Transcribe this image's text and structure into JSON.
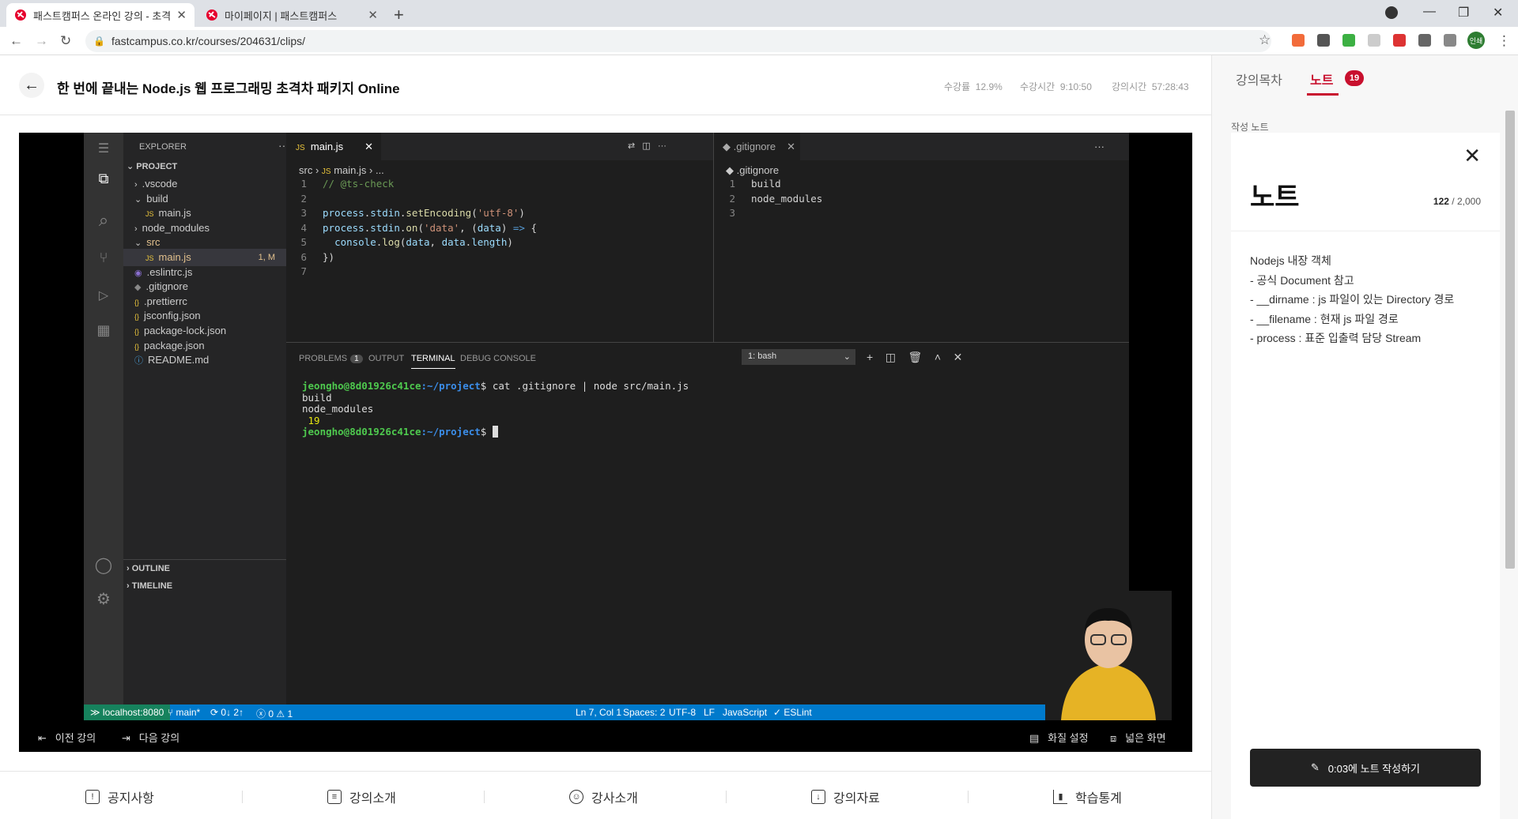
{
  "browser": {
    "tabs": [
      {
        "title": "패스트캠퍼스 온라인 강의 - 초격",
        "active": true
      },
      {
        "title": "마이페이지 | 패스트캠퍼스",
        "active": false
      }
    ],
    "url": "fastcampus.co.kr/courses/204631/clips/",
    "profile_label": "인쇄"
  },
  "header": {
    "title": "한 번에 끝내는 Node.js 웹 프로그래밍 초격차 패키지 Online",
    "progress_label": "수강률",
    "progress_value": "12.9%",
    "watch_time_label": "수강시간",
    "watch_time_value": "9:10:50",
    "lecture_time_label": "강의시간",
    "lecture_time_value": "57:28:43"
  },
  "right_panel": {
    "tabs": [
      {
        "label": "강의목차",
        "active": false
      },
      {
        "label": "노트",
        "active": true
      }
    ],
    "note_badge": "19",
    "section_label": "작성 노트",
    "note_heading": "노트",
    "char_count": "122",
    "char_limit": "/ 2,000",
    "note_lines": [
      "Nodejs 내장 객체",
      "- 공식 Document 참고",
      "- __dirname : js 파일이 있는 Directory 경로",
      "- __filename : 현재 js 파일 경로",
      "- process : 표준 입출력 담당 Stream"
    ],
    "write_button": "0:03에 노트 작성하기"
  },
  "vscode": {
    "explorer_title": "EXPLORER",
    "project_label": "PROJECT",
    "files": [
      {
        "name": ".vscode",
        "indent": 1,
        "type": "folder"
      },
      {
        "name": "build",
        "indent": 1,
        "type": "folder-open"
      },
      {
        "name": "main.js",
        "indent": 2,
        "type": "js"
      },
      {
        "name": "node_modules",
        "indent": 1,
        "type": "folder"
      },
      {
        "name": "src",
        "indent": 1,
        "type": "folder-open"
      },
      {
        "name": "main.js",
        "indent": 2,
        "type": "js",
        "selected": true,
        "status": "1, M"
      },
      {
        "name": ".eslintrc.js",
        "indent": 1,
        "type": "eslint"
      },
      {
        "name": ".gitignore",
        "indent": 1,
        "type": "git"
      },
      {
        "name": ".prettierrc",
        "indent": 1,
        "type": "json"
      },
      {
        "name": "jsconfig.json",
        "indent": 1,
        "type": "json"
      },
      {
        "name": "package-lock.json",
        "indent": 1,
        "type": "json"
      },
      {
        "name": "package.json",
        "indent": 1,
        "type": "json"
      },
      {
        "name": "README.md",
        "indent": 1,
        "type": "info"
      }
    ],
    "outline_label": "OUTLINE",
    "timeline_label": "TIMELINE",
    "tab_main": "main.js",
    "tab_gitignore": ".gitignore",
    "crumb_src": "src",
    "crumb_file": "main.js",
    "crumb_more": "...",
    "crumb_git": ".gitignore",
    "main_code": [
      "// @ts-check",
      "",
      "process.stdin.setEncoding('utf-8')",
      "process.stdin.on('data', (data) => {",
      "  console.log(data, data.length)",
      "})",
      ""
    ],
    "git_code": [
      "build",
      "node_modules",
      ""
    ],
    "panel_tabs": [
      "PROBLEMS",
      "OUTPUT",
      "TERMINAL",
      "DEBUG CONSOLE"
    ],
    "problems_count": "1",
    "terminal_select": "1: bash",
    "terminal": {
      "prompt_user": "jeongho@8d01926c41ce",
      "prompt_path": ":~/project",
      "command": "$ cat .gitignore | node src/main.js",
      "out1": "build",
      "out2": "node_modules",
      "out3": " 19",
      "final_prompt": "$ "
    },
    "statusbar": {
      "remote": "localhost:8080",
      "branch": "main*",
      "sync": "0↓ 2↑",
      "errors": "0",
      "warnings": "1",
      "position": "Ln 7, Col 1",
      "spaces": "Spaces: 2",
      "encoding": "UTF-8",
      "eol": "LF",
      "language": "JavaScript",
      "lint": "ESLint"
    }
  },
  "video_controls": {
    "prev": "이전 강의",
    "next": "다음 강의",
    "quality": "화질 설정",
    "wide": "넓은 화면"
  },
  "bottom_nav": [
    "공지사항",
    "강의소개",
    "강사소개",
    "강의자료",
    "학습통계"
  ]
}
